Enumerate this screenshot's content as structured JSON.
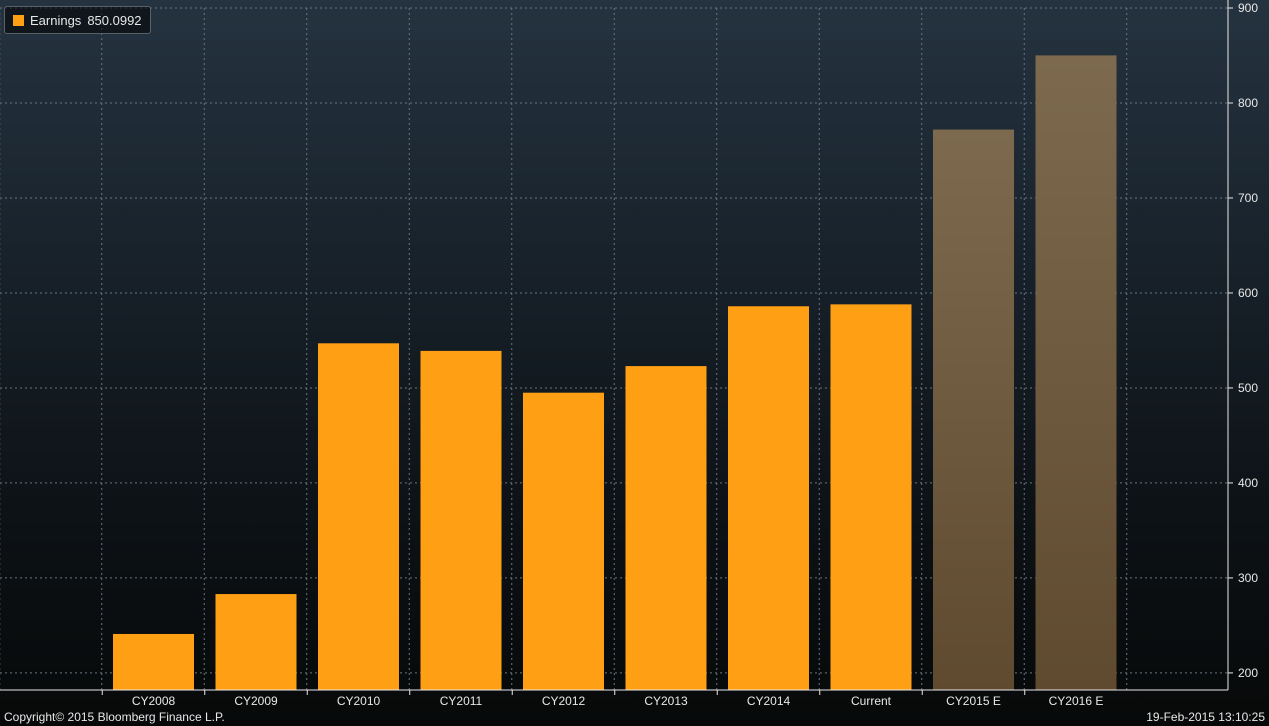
{
  "legend": {
    "series_label": "Earnings",
    "series_value": "850.0992"
  },
  "footer": {
    "copyright": "Copyright© 2015 Bloomberg Finance L.P.",
    "timestamp": "19-Feb-2015 13:10:25"
  },
  "colors": {
    "actual_bar": "#ff9f14",
    "estimate_bar": "#7a6548",
    "grid": "#6a7480",
    "axis_text": "#e8e8e8"
  },
  "chart_data": {
    "type": "bar",
    "title": "",
    "xlabel": "",
    "ylabel": "",
    "ylim": [
      182,
      900
    ],
    "y_ticks": [
      200,
      300,
      400,
      500,
      600,
      700,
      800,
      900
    ],
    "y_axis_side": "right",
    "grid": true,
    "legend_position": "top-left",
    "categories": [
      "CY2008",
      "CY2009",
      "CY2010",
      "CY2011",
      "CY2012",
      "CY2013",
      "CY2014",
      "Current",
      "CY2015 E",
      "CY2016 E"
    ],
    "series": [
      {
        "name": "Earnings",
        "values": [
          241,
          283,
          547,
          539,
          495,
          523,
          586,
          588,
          772,
          850.0992
        ],
        "estimate": [
          false,
          false,
          false,
          false,
          false,
          false,
          false,
          false,
          true,
          true
        ]
      }
    ]
  }
}
